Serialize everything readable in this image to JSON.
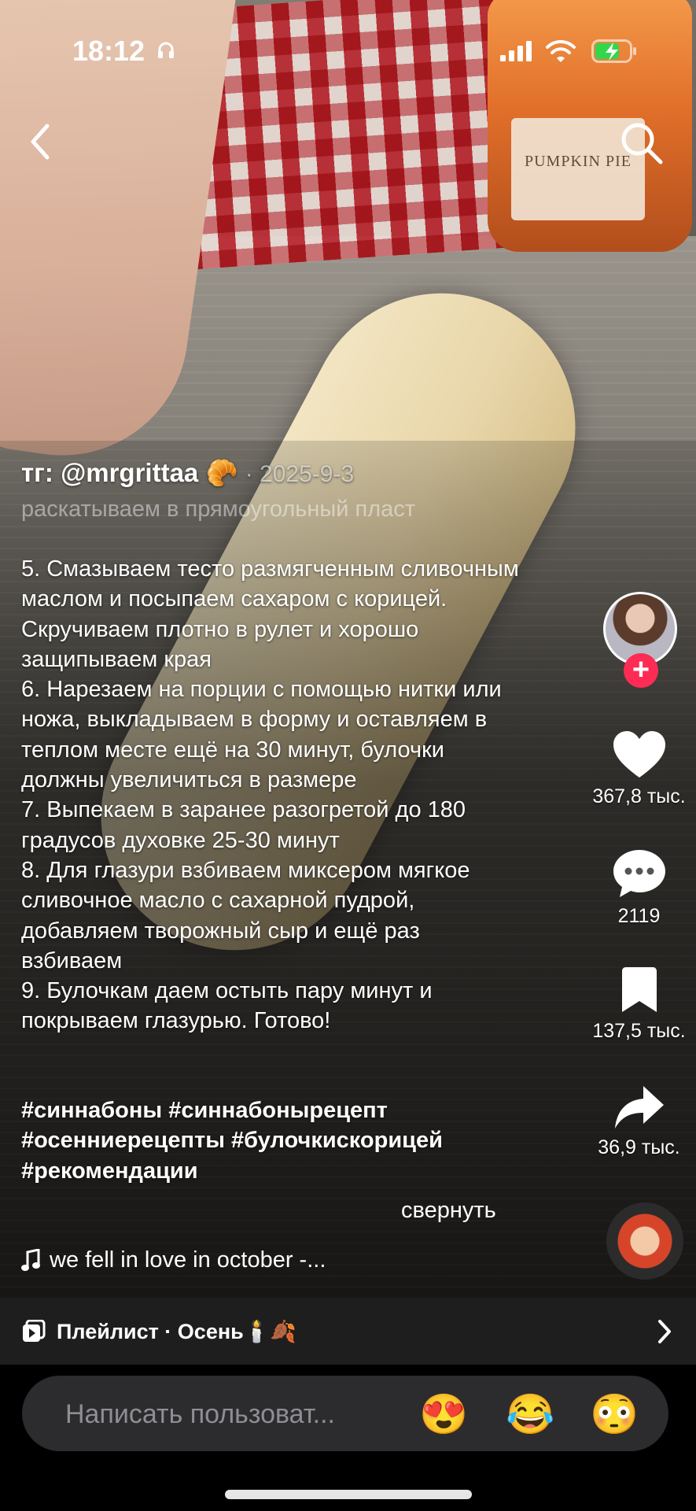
{
  "status_bar": {
    "time": "18:12"
  },
  "header": {
    "back_icon": "chevron-left-icon",
    "search_icon": "search-icon"
  },
  "video": {
    "candle_label": "PUMPKIN PIE"
  },
  "caption": {
    "author": "тг: @mrgrittaa 🥐",
    "date": "· 2025-9-3",
    "faded_line": "раскатываем в прямоугольный пласт",
    "body": "5. Смазываем тесто размягченным сливочным маслом и посыпаем сахаром с корицей. Скручиваем плотно в рулет и хорошо защипываем края\n6. Нарезаем на порции с помощью нитки или ножа, выкладываем в форму и оставляем в теплом месте ещё на 30 минут, булочки должны увеличиться в размере\n7. Выпекаем в заранее разогретой до 180 градусов духовке 25-30 минут\n8. Для глазури взбиваем миксером мягкое сливочное масло с сахарной пудрой, добавляем творожный сыр и ещё раз взбиваем\n9. Булочкам даем остыть пару минут и покрываем глазурью. Готово!",
    "tags": "#синнабоны #синнабонырецепт #осенниерецепты #булочкискорицей #рекомендации",
    "collapse_label": "свернуть"
  },
  "music": {
    "track": "we fell in love in october -..."
  },
  "actions": {
    "likes": "367,8 тыс.",
    "comments": "2119",
    "saves": "137,5 тыс.",
    "shares": "36,9 тыс.",
    "follow_symbol": "+"
  },
  "playlist": {
    "label": "Плейлист · Осень🕯️🍂"
  },
  "comment_bar": {
    "placeholder": "Написать пользоват...",
    "emojis": [
      "😍",
      "😂",
      "😳"
    ]
  },
  "colors": {
    "follow_accent": "#fe2c55",
    "bar_bg": "#1e1e1e",
    "input_bg": "#2c2c2e"
  }
}
